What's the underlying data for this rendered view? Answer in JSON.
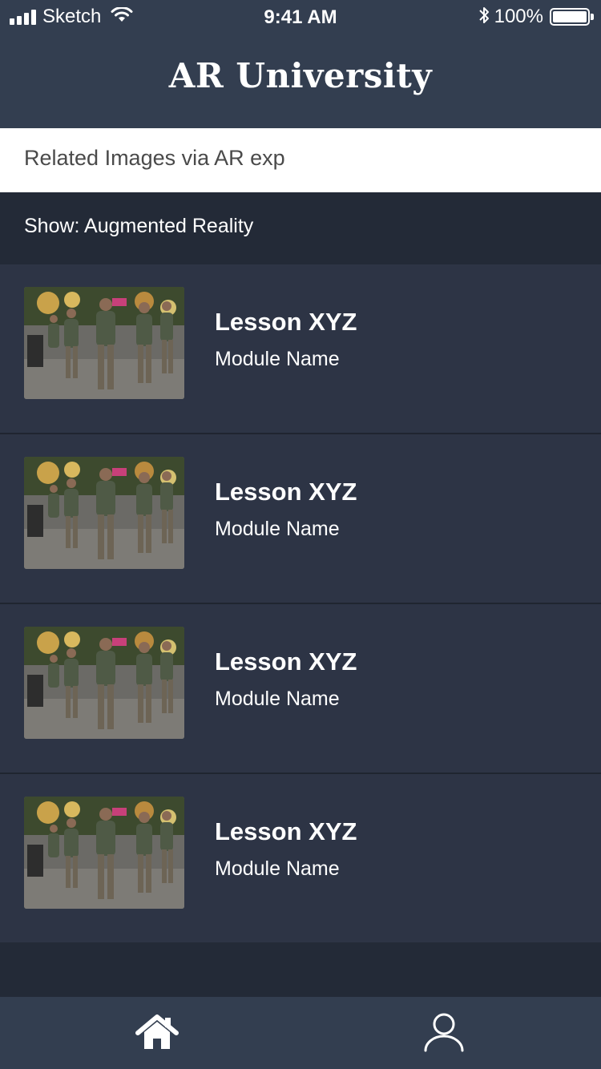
{
  "status_bar": {
    "carrier": "Sketch",
    "time": "9:41 AM",
    "battery": "100%"
  },
  "header": {
    "title": "AR University"
  },
  "search": {
    "text": "Related Images via AR exp"
  },
  "filter": {
    "label": "Show: Augmented Reality"
  },
  "lessons": [
    {
      "title": "Lesson XYZ",
      "module": "Module Name"
    },
    {
      "title": "Lesson XYZ",
      "module": "Module Name"
    },
    {
      "title": "Lesson XYZ",
      "module": "Module Name"
    },
    {
      "title": "Lesson XYZ",
      "module": "Module Name"
    }
  ],
  "tab_bar": {
    "tabs": [
      {
        "icon": "home-icon"
      },
      {
        "icon": "profile-icon"
      }
    ]
  },
  "colors": {
    "nav": "#333e50",
    "list_bg": "#2d3445",
    "dark_bg": "#232a37",
    "search_bg": "#ffffff"
  }
}
